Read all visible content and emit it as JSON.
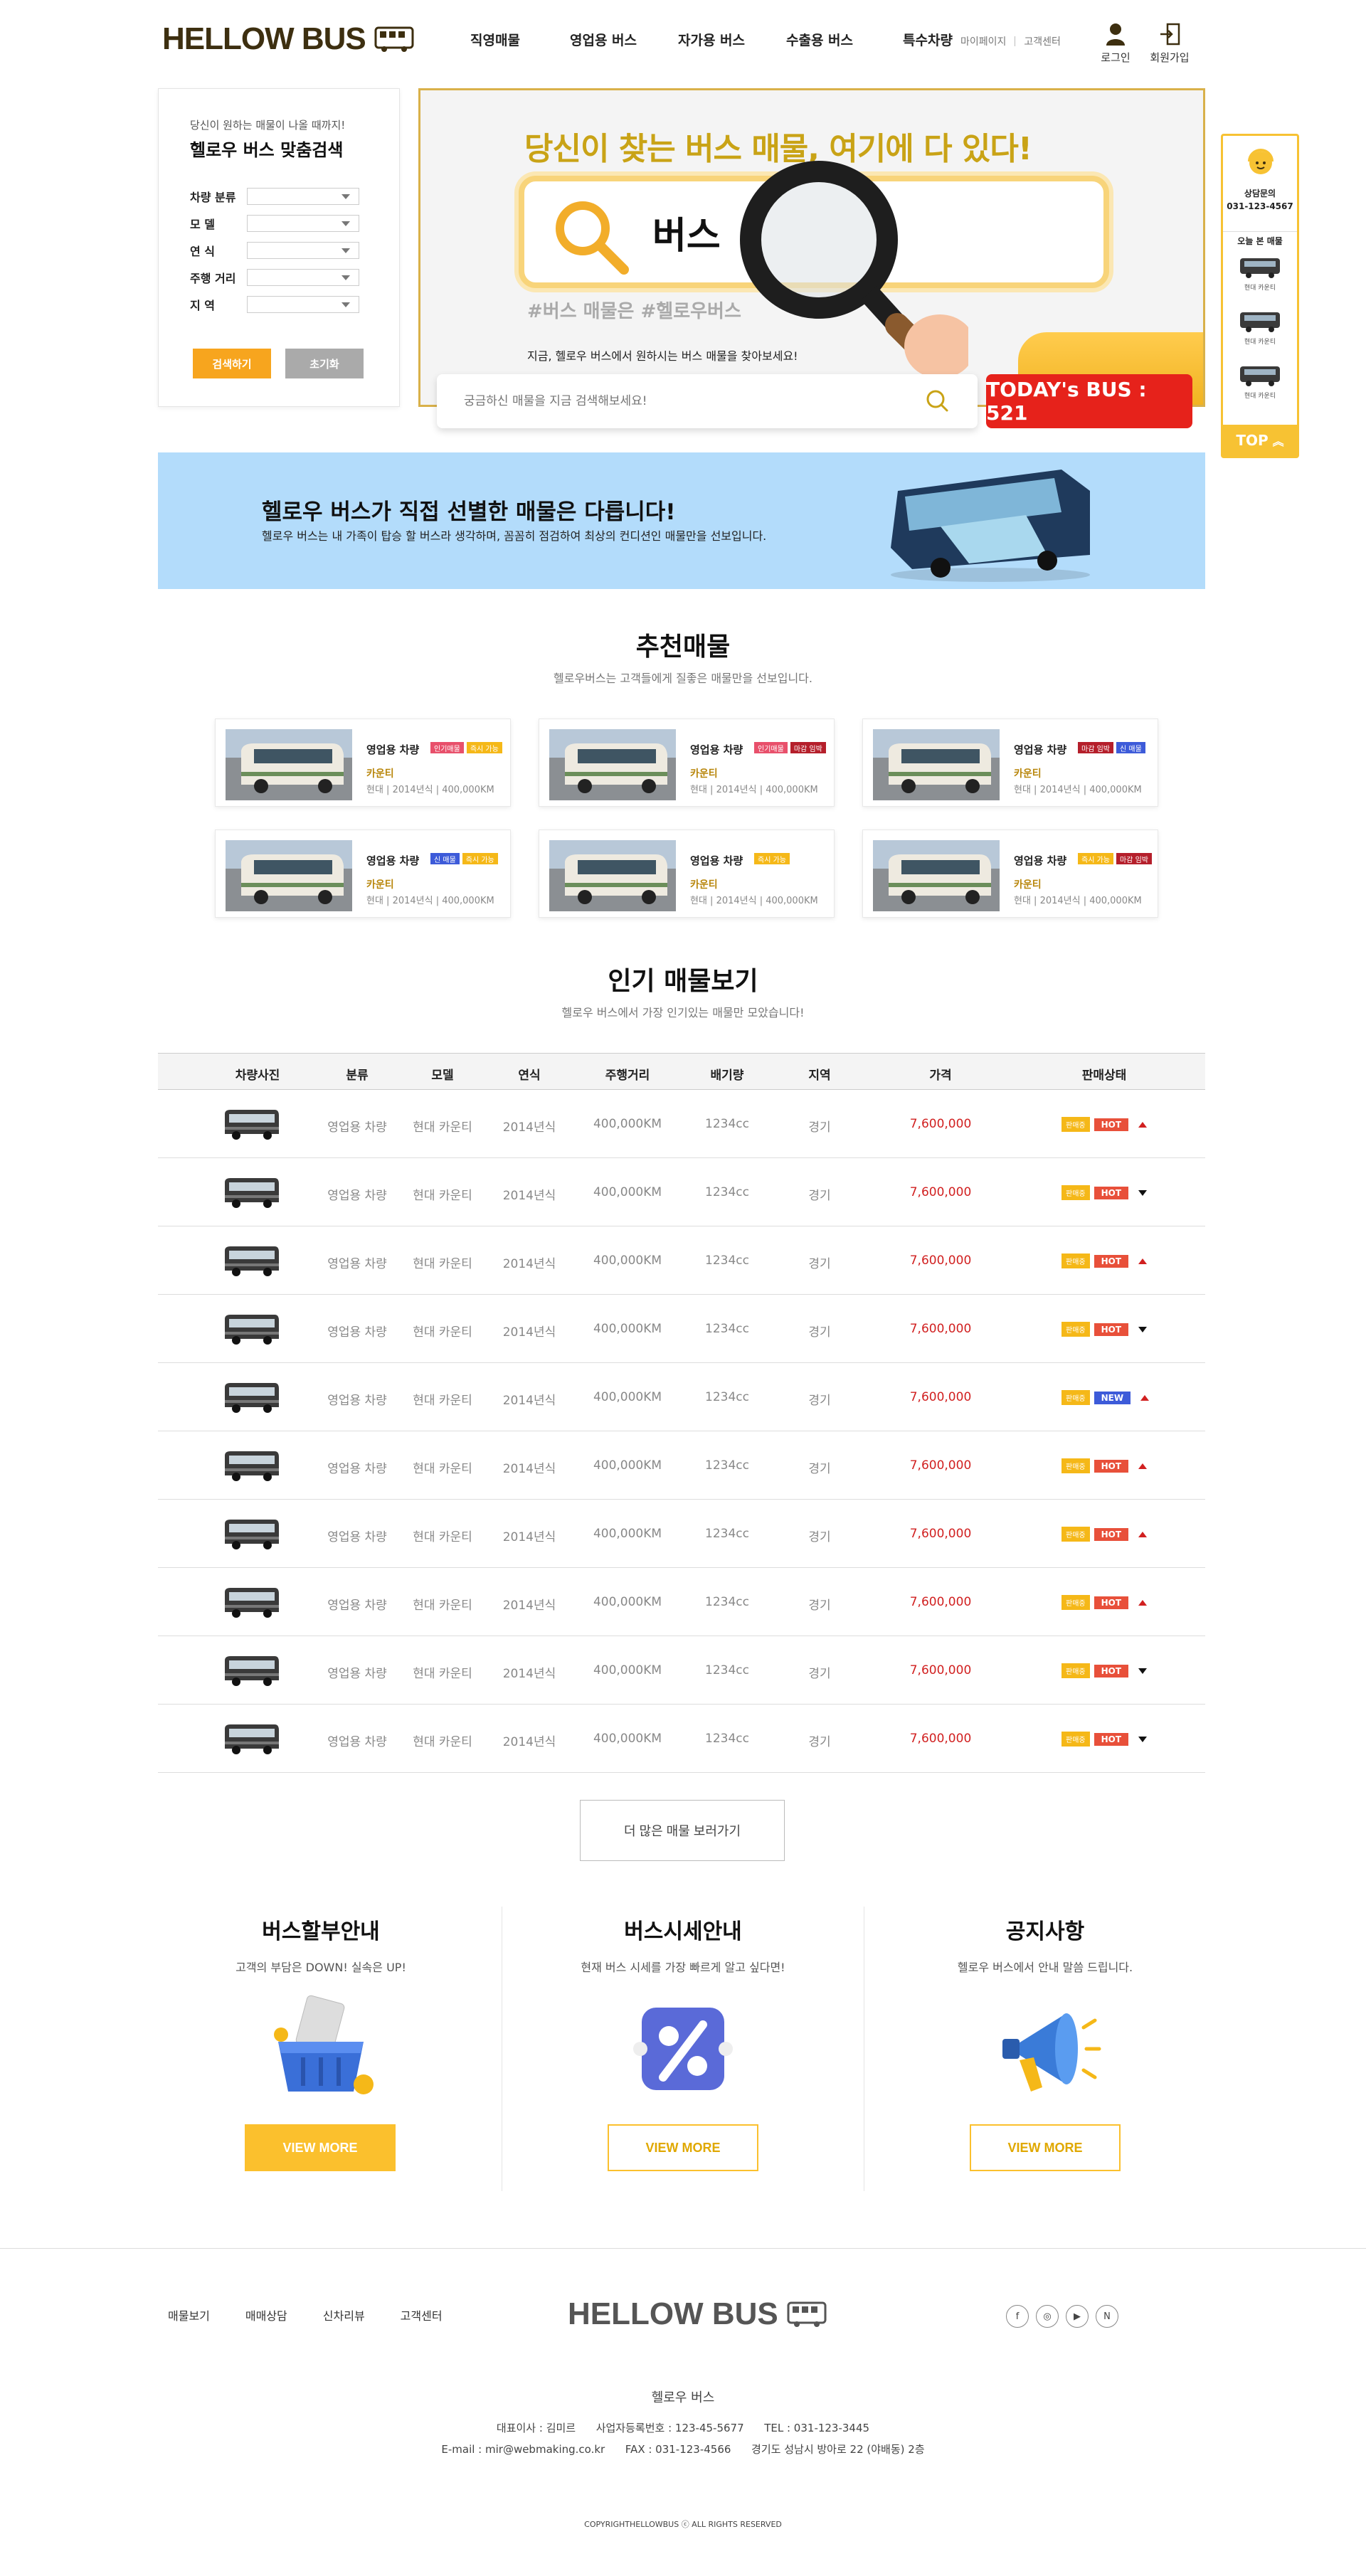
{
  "header": {
    "logo": "HELLOW BUS",
    "nav": [
      "직영매물",
      "영업용 버스",
      "자가용 버스",
      "수출용 버스",
      "특수차량"
    ],
    "util_links": [
      "마이페이지",
      "고객센터"
    ],
    "login": "로그인",
    "signup": "회원가입"
  },
  "search_panel": {
    "subtitle": "당신이 원하는 매물이 나올 때까지!",
    "title": "헬로우 버스 맞춤검색",
    "fields": [
      "차량 분류",
      "모 델",
      "연 식",
      "주행 거리",
      "지 역"
    ],
    "search_btn": "검색하기",
    "reset_btn": "초기화"
  },
  "hero": {
    "title": "당신이 찾는 버스 매물, 여기에 다 있다!",
    "search_word": "버스",
    "tags": "#버스 매물은  #헬로우버스",
    "desc": "지금, 헬로우 버스에서 원하시는 버스 매물을 찾아보세요!",
    "input_placeholder": "궁금하신 매물을 지금 검색해보세요!",
    "today": "TODAY's BUS : 521"
  },
  "quick": {
    "center_label": "상담문의",
    "phone": "031-123-4567",
    "recent_label": "오늘 본 매물",
    "items": [
      "현대 카운티",
      "현대 카운티",
      "현대 카운티"
    ],
    "top": "TOP"
  },
  "banner": {
    "title": "헬로우 버스가 직접 선별한 매물은 다릅니다!",
    "desc": "헬로우 버스는 내 가족이 탑승 할 버스라 생각하며, 꼼꼼히 점검하여 최상의 컨디션인 매물만을 선보입니다."
  },
  "recommended": {
    "title": "추천매물",
    "subtitle": "헬로우버스는 고객들에게 질좋은 매물만을 선보입니다.",
    "cards": [
      {
        "category": "영업용 차량",
        "badges": [
          {
            "t": "인기매물",
            "c": "#e8506b"
          },
          {
            "t": "즉시 가능",
            "c": "#f5b818"
          }
        ],
        "model": "카운티",
        "spec": "현대 | 2014년식 | 400,000KM"
      },
      {
        "category": "영업용 차량",
        "badges": [
          {
            "t": "인기매물",
            "c": "#e8506b"
          },
          {
            "t": "마감 임박",
            "c": "#b51f2b"
          }
        ],
        "model": "카운티",
        "spec": "현대 | 2014년식 | 400,000KM"
      },
      {
        "category": "영업용 차량",
        "badges": [
          {
            "t": "마감 임박",
            "c": "#b51f2b"
          },
          {
            "t": "신 매물",
            "c": "#3d5bd9"
          }
        ],
        "model": "카운티",
        "spec": "현대 | 2014년식 | 400,000KM"
      },
      {
        "category": "영업용 차량",
        "badges": [
          {
            "t": "신 매물",
            "c": "#3d5bd9"
          },
          {
            "t": "즉시 가능",
            "c": "#f5b818"
          }
        ],
        "model": "카운티",
        "spec": "현대 | 2014년식 | 400,000KM"
      },
      {
        "category": "영업용 차량",
        "badges": [
          {
            "t": "즉시 가능",
            "c": "#f5b818"
          }
        ],
        "model": "카운티",
        "spec": "현대 | 2014년식 | 400,000KM"
      },
      {
        "category": "영업용 차량",
        "badges": [
          {
            "t": "즉시 가능",
            "c": "#f5b818"
          },
          {
            "t": "마감 임박",
            "c": "#b51f2b"
          }
        ],
        "model": "카운티",
        "spec": "현대 | 2014년식 | 400,000KM"
      }
    ]
  },
  "popular": {
    "title": "인기 매물보기",
    "subtitle": "헬로우 버스에서 가장 인기있는 매물만 모았습니다!",
    "columns": [
      "차량사진",
      "분류",
      "모델",
      "연식",
      "주행거리",
      "배기량",
      "지역",
      "가격",
      "판매상태"
    ],
    "rows": [
      {
        "cat": "영업용 차량",
        "model": "현대 카운티",
        "year": "2014년식",
        "km": "400,000KM",
        "cc": "1234cc",
        "region": "경기",
        "price": "7,600,000",
        "sale": "판매중",
        "tag": "HOT",
        "trend": "up"
      },
      {
        "cat": "영업용 차량",
        "model": "현대 카운티",
        "year": "2014년식",
        "km": "400,000KM",
        "cc": "1234cc",
        "region": "경기",
        "price": "7,600,000",
        "sale": "판매중",
        "tag": "HOT",
        "trend": "down"
      },
      {
        "cat": "영업용 차량",
        "model": "현대 카운티",
        "year": "2014년식",
        "km": "400,000KM",
        "cc": "1234cc",
        "region": "경기",
        "price": "7,600,000",
        "sale": "판매중",
        "tag": "HOT",
        "trend": "up"
      },
      {
        "cat": "영업용 차량",
        "model": "현대 카운티",
        "year": "2014년식",
        "km": "400,000KM",
        "cc": "1234cc",
        "region": "경기",
        "price": "7,600,000",
        "sale": "판매중",
        "tag": "HOT",
        "trend": "down"
      },
      {
        "cat": "영업용 차량",
        "model": "현대 카운티",
        "year": "2014년식",
        "km": "400,000KM",
        "cc": "1234cc",
        "region": "경기",
        "price": "7,600,000",
        "sale": "판매중",
        "tag": "NEW",
        "trend": "up"
      },
      {
        "cat": "영업용 차량",
        "model": "현대 카운티",
        "year": "2014년식",
        "km": "400,000KM",
        "cc": "1234cc",
        "region": "경기",
        "price": "7,600,000",
        "sale": "판매중",
        "tag": "HOT",
        "trend": "up"
      },
      {
        "cat": "영업용 차량",
        "model": "현대 카운티",
        "year": "2014년식",
        "km": "400,000KM",
        "cc": "1234cc",
        "region": "경기",
        "price": "7,600,000",
        "sale": "판매중",
        "tag": "HOT",
        "trend": "up"
      },
      {
        "cat": "영업용 차량",
        "model": "현대 카운티",
        "year": "2014년식",
        "km": "400,000KM",
        "cc": "1234cc",
        "region": "경기",
        "price": "7,600,000",
        "sale": "판매중",
        "tag": "HOT",
        "trend": "up"
      },
      {
        "cat": "영업용 차량",
        "model": "현대 카운티",
        "year": "2014년식",
        "km": "400,000KM",
        "cc": "1234cc",
        "region": "경기",
        "price": "7,600,000",
        "sale": "판매중",
        "tag": "HOT",
        "trend": "down"
      },
      {
        "cat": "영업용 차량",
        "model": "현대 카운티",
        "year": "2014년식",
        "km": "400,000KM",
        "cc": "1234cc",
        "region": "경기",
        "price": "7,600,000",
        "sale": "판매중",
        "tag": "HOT",
        "trend": "down"
      }
    ],
    "more": "더 많은 매물 보러가기"
  },
  "info": [
    {
      "title": "버스할부안내",
      "sub": "고객의 부담은 DOWN! 실속은 UP!",
      "btn": "VIEW MORE"
    },
    {
      "title": "버스시세안내",
      "sub": "현재 버스 시세를 가장 빠르게 알고 싶다면!",
      "btn": "VIEW MORE"
    },
    {
      "title": "공지사항",
      "sub": "헬로우 버스에서 안내 말씀 드립니다.",
      "btn": "VIEW MORE"
    }
  ],
  "footer": {
    "nav": [
      "매물보기",
      "매매상담",
      "신차리뷰",
      "고객센터"
    ],
    "logo": "HELLOW BUS",
    "company": "헬로우 버스",
    "line1": "대표이사 : 김미르      사업자등록번호 : 123-45-5677      TEL : 031-123-3445",
    "line2": "E-mail : mir@webmaking.co.kr      FAX : 031-123-4566      경기도 성남시 방아로 22 (야배동) 2층",
    "copyright": "COPYRIGHTHELLOWBUS ⓒ ALL RIGHTS RESERVED",
    "sns": [
      "f",
      "◎",
      "▶",
      "N"
    ]
  },
  "colors": {
    "accent": "#f7c233",
    "orange": "#f7a51e",
    "red": "#e6221b",
    "gold": "#c9a316",
    "banner": "#b3dcfb",
    "hot": "#e8503a",
    "new": "#3d5bd9"
  }
}
